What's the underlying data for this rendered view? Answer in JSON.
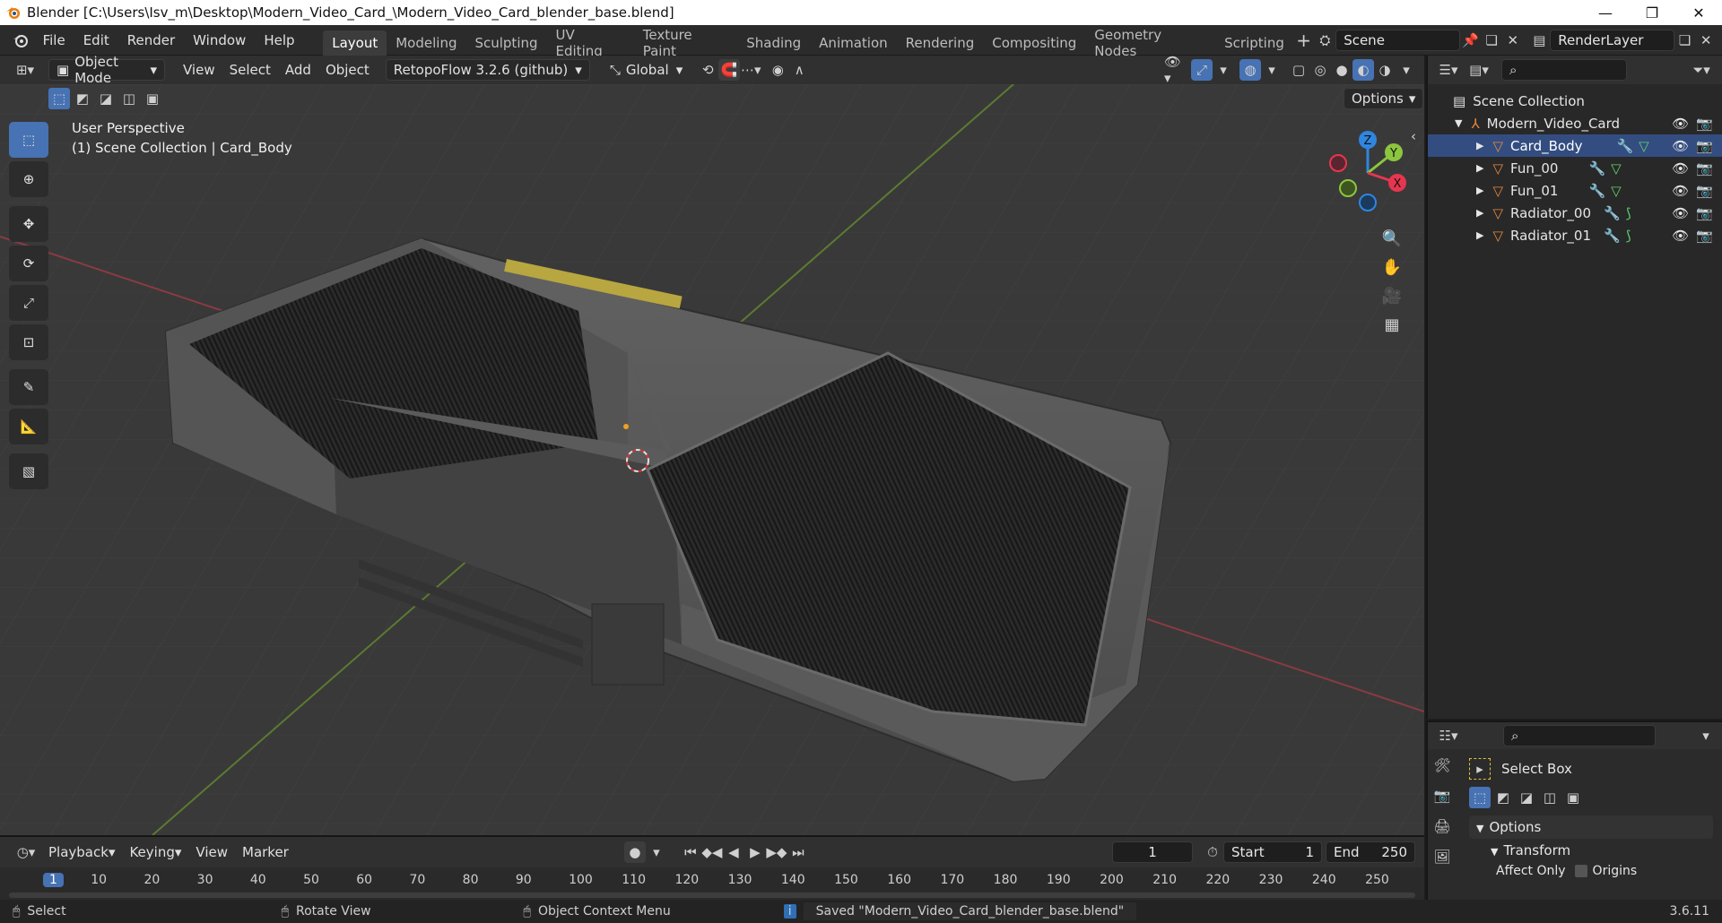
{
  "window": {
    "title": "Blender [C:\\Users\\Isv_m\\Desktop\\Modern_Video_Card_\\Modern_Video_Card_blender_base.blend]"
  },
  "menu": [
    "File",
    "Edit",
    "Render",
    "Window",
    "Help"
  ],
  "workspaces": [
    "Layout",
    "Modeling",
    "Sculpting",
    "UV Editing",
    "Texture Paint",
    "Shading",
    "Animation",
    "Rendering",
    "Compositing",
    "Geometry Nodes",
    "Scripting"
  ],
  "active_workspace": "Layout",
  "scene": {
    "name": "Scene",
    "render_layer": "RenderLayer"
  },
  "viewport_header": {
    "mode": "Object Mode",
    "menus": [
      "View",
      "Select",
      "Add",
      "Object"
    ],
    "addon": "RetopoFlow 3.2.6 (github)",
    "orientation": "Global",
    "options": "Options"
  },
  "viewport": {
    "perspective": "User Perspective",
    "collection_info": "(1) Scene Collection | Card_Body"
  },
  "gizmo": {
    "x": "X",
    "y": "Y",
    "z": "Z"
  },
  "outliner": {
    "root": "Scene Collection",
    "collection": "Modern_Video_Card",
    "objects": [
      "Card_Body",
      "Fun_00",
      "Fun_01",
      "Radiator_00",
      "Radiator_01"
    ]
  },
  "properties": {
    "tool": "Select Box",
    "options": "Options",
    "transform": "Transform",
    "affect_only": "Affect Only",
    "origins": "Origins"
  },
  "timeline": {
    "menus": [
      "Playback",
      "Keying",
      "View",
      "Marker"
    ],
    "current_frame": "1",
    "start_label": "Start",
    "start": "1",
    "end_label": "End",
    "end": "250",
    "ticks": [
      "1",
      "10",
      "20",
      "30",
      "40",
      "50",
      "60",
      "70",
      "80",
      "90",
      "100",
      "110",
      "120",
      "130",
      "140",
      "150",
      "160",
      "170",
      "180",
      "190",
      "200",
      "210",
      "220",
      "230",
      "240",
      "250"
    ]
  },
  "statusbar": {
    "select": "Select",
    "rotate": "Rotate View",
    "context": "Object Context Menu",
    "message": "Saved \"Modern_Video_Card_blender_base.blend\"",
    "version": "3.6.11"
  },
  "colors": {
    "accent": "#4772b3",
    "object_icon": "#e8893a",
    "axis_x": "#e6364f",
    "axis_y": "#8cc63f",
    "axis_z": "#2f86e0"
  }
}
